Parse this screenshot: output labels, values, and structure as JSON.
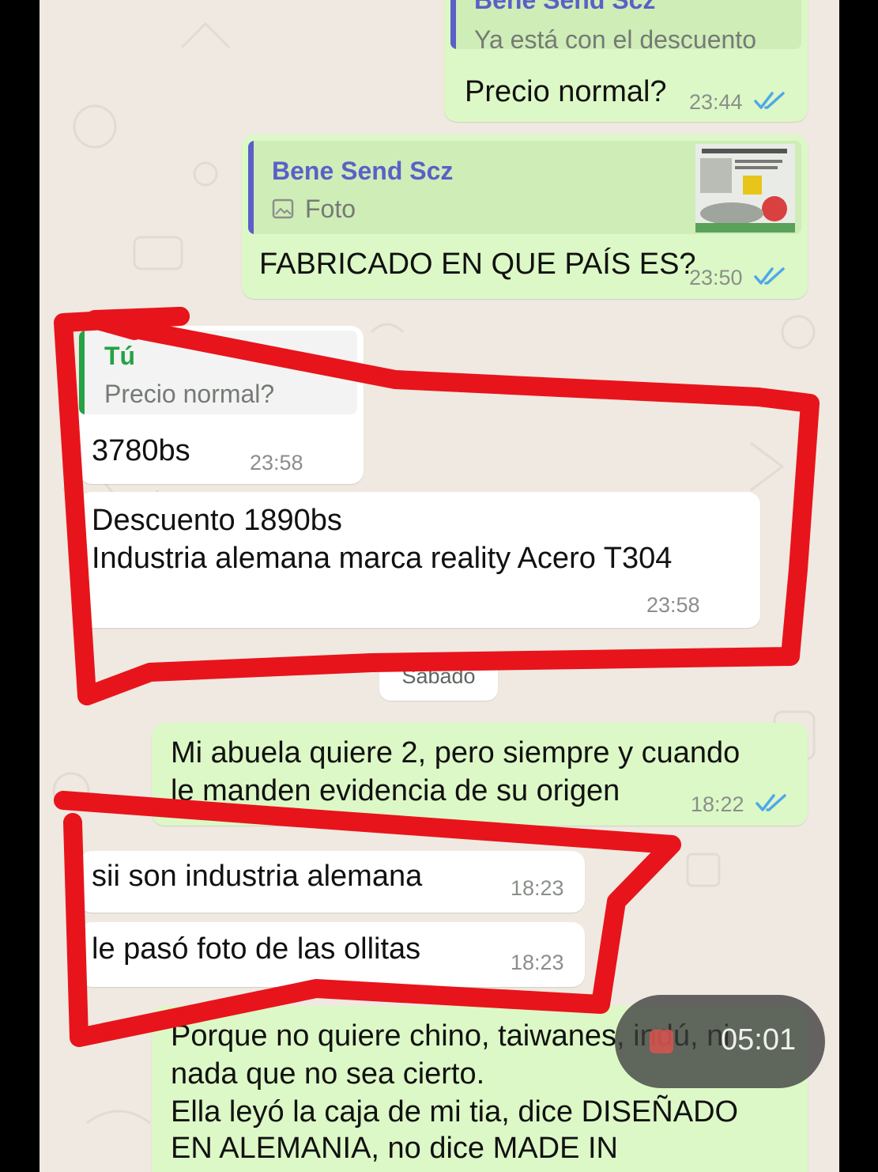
{
  "messages": [
    {
      "quote_name": "Bene Send Scz",
      "quote_text": "Ya está con el descuento",
      "text": "Precio normal?",
      "time": "23:44"
    },
    {
      "quote_name": "Bene Send Scz",
      "quote_text": "Foto",
      "text": "FABRICADO EN QUE PAÍS ES?",
      "time": "23:50"
    },
    {
      "quote_name": "Tú",
      "quote_text": "Precio normal?",
      "text": "3780bs",
      "time": "23:58"
    },
    {
      "line1": "Descuento 1890bs",
      "line2": "Industria alemana marca reality Acero T304",
      "time": "23:58"
    },
    {
      "line1": "Mi abuela quiere 2, pero siempre y cuando",
      "line2": "le manden evidencia de su origen",
      "time": "18:22"
    },
    {
      "text": "sii son industria alemana",
      "time": "18:23"
    },
    {
      "text": "le pasó foto de las ollitas",
      "time": "18:23"
    },
    {
      "line1": "Porque no quiere chino, taiwanes, indú, ni",
      "line2": "nada que no sea cierto.",
      "line3": "Ella leyó la caja de mi tia, dice DISEÑADO",
      "line4": "EN ALEMANIA, no dice MADE IN"
    }
  ],
  "day_separator": "Sábado",
  "recording": {
    "time": "05:01"
  },
  "colors": {
    "outgoing_bubble": "#dcf8c6",
    "incoming_bubble": "#ffffff",
    "chat_background": "#efe9e1",
    "read_ticks": "#4fa8e8",
    "quote_name_other": "#5b5fc7",
    "quote_name_self": "#25a244",
    "annotation": "#e8141b"
  }
}
